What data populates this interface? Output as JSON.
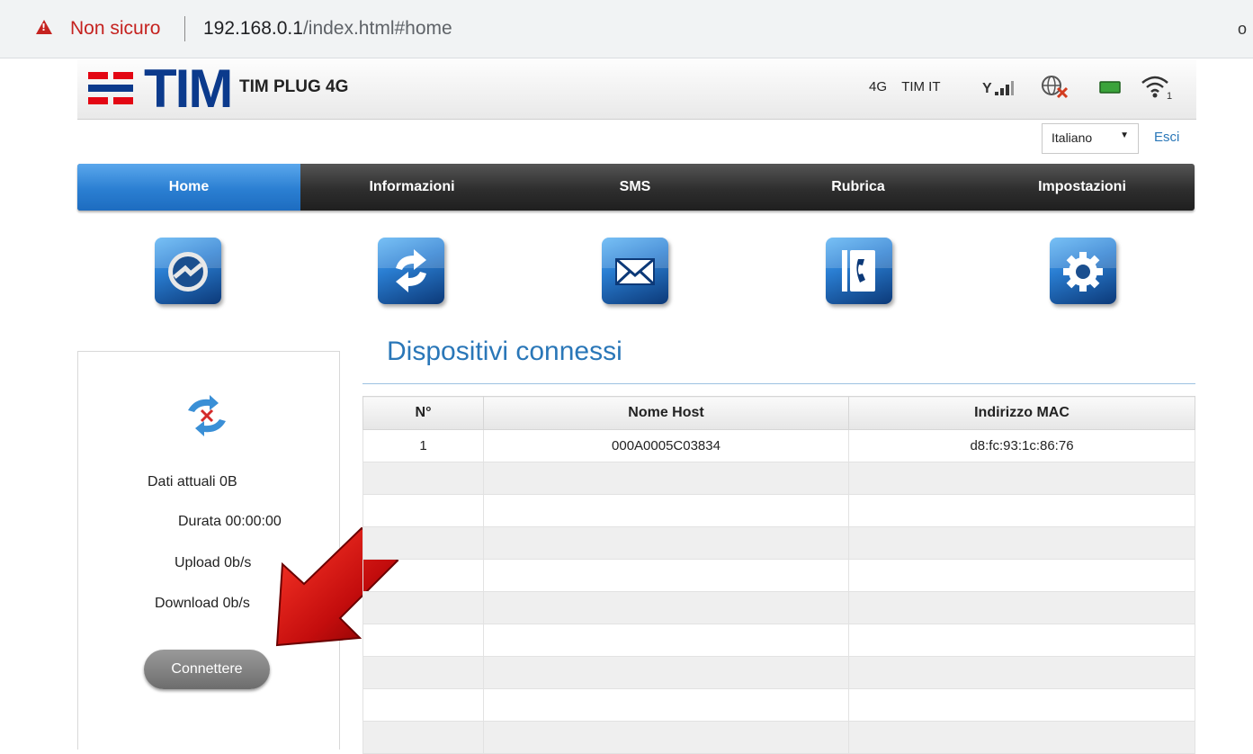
{
  "browser": {
    "security_label": "Non sicuro",
    "url_host": "192.168.0.1",
    "url_path": "/index.html#home"
  },
  "header": {
    "brand": "TIM",
    "model": "TIM PLUG 4G",
    "network_type": "4G",
    "operator": "TIM IT"
  },
  "language": {
    "selected": "Italiano"
  },
  "logout_label": "Esci",
  "nav": {
    "items": [
      {
        "label": "Home",
        "active": true
      },
      {
        "label": "Informazioni",
        "active": false
      },
      {
        "label": "SMS",
        "active": false
      },
      {
        "label": "Rubrica",
        "active": false
      },
      {
        "label": "Impostazioni",
        "active": false
      }
    ]
  },
  "shortcuts": [
    "connection-icon",
    "refresh-icon",
    "envelope-icon",
    "phone-book-icon",
    "gear-icon"
  ],
  "status": {
    "data_label": "Dati attuali 0B",
    "duration_label": "Durata 00:00:00",
    "upload_label": "Upload 0b/s",
    "download_label": "Download 0b/s",
    "connect_button": "Connettere"
  },
  "devices": {
    "title": "Dispositivi connessi",
    "columns": [
      "N°",
      "Nome Host",
      "Indirizzo MAC"
    ],
    "rows": [
      {
        "n": "1",
        "host": "000A0005C03834",
        "mac": "d8:fc:93:1c:86:76"
      }
    ]
  },
  "colors": {
    "accent": "#2a77b8",
    "brand_red": "#e30613",
    "brand_blue": "#0b3a8c"
  }
}
